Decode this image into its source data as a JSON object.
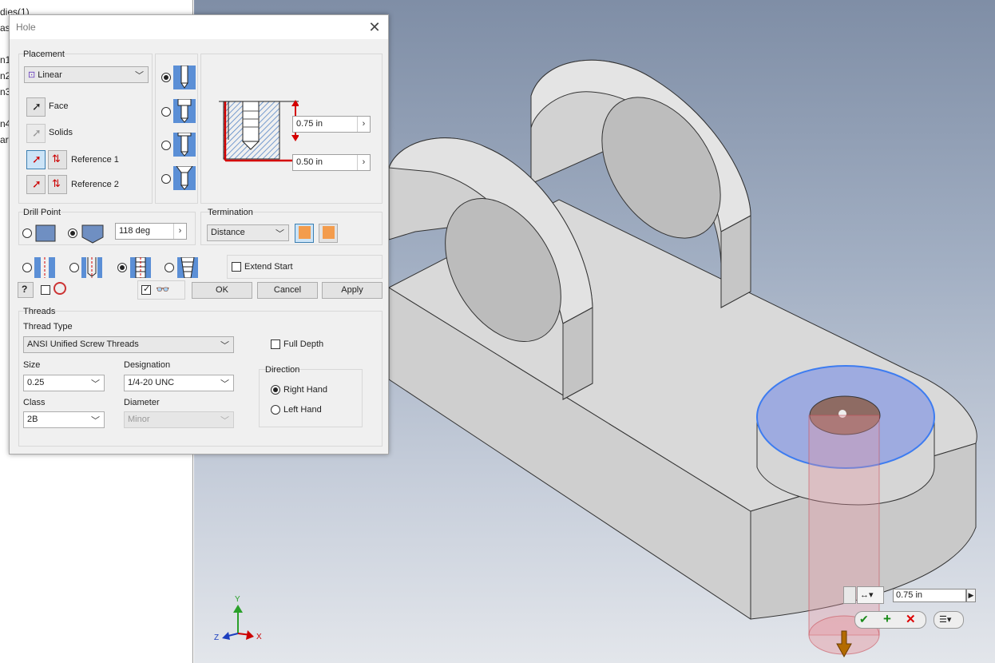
{
  "browser": {
    "items": [
      "dies(1)",
      "ast",
      "n1",
      "n2",
      "n3",
      "n4",
      "art"
    ]
  },
  "dialog": {
    "title": "Hole",
    "placement": {
      "group_title": "Placement",
      "type_value": "Linear",
      "face_label": "Face",
      "solids_label": "Solids",
      "reference1_label": "Reference 1",
      "reference2_label": "Reference 2"
    },
    "dimensions": {
      "depth_value": "0.75 in",
      "diameter_value": "0.50 in"
    },
    "drill_point": {
      "group_title": "Drill Point",
      "angle_value": "118 deg"
    },
    "termination": {
      "group_title": "Termination",
      "value": "Distance"
    },
    "extend_start_label": "Extend Start",
    "buttons": {
      "ok": "OK",
      "cancel": "Cancel",
      "apply": "Apply"
    },
    "threads": {
      "group_title": "Threads",
      "thread_type_label": "Thread Type",
      "thread_type_value": "ANSI Unified Screw Threads",
      "full_depth_label": "Full Depth",
      "size_label": "Size",
      "size_value": "0.25",
      "designation_label": "Designation",
      "designation_value": "1/4-20 UNC",
      "class_label": "Class",
      "class_value": "2B",
      "diameter_label": "Diameter",
      "diameter_value": "Minor",
      "direction_title": "Direction",
      "right_hand_label": "Right Hand",
      "left_hand_label": "Left Hand"
    }
  },
  "minitoolbar": {
    "distance_value": "0.75 in"
  },
  "triad": {
    "x": "X",
    "y": "Y",
    "z": "Z"
  },
  "colors": {
    "accent_blue": "#3c7fb1",
    "dimension_red": "#d40000",
    "hole_cap_blue": "#9eabe0",
    "part_grey": "#dcdcdc"
  }
}
